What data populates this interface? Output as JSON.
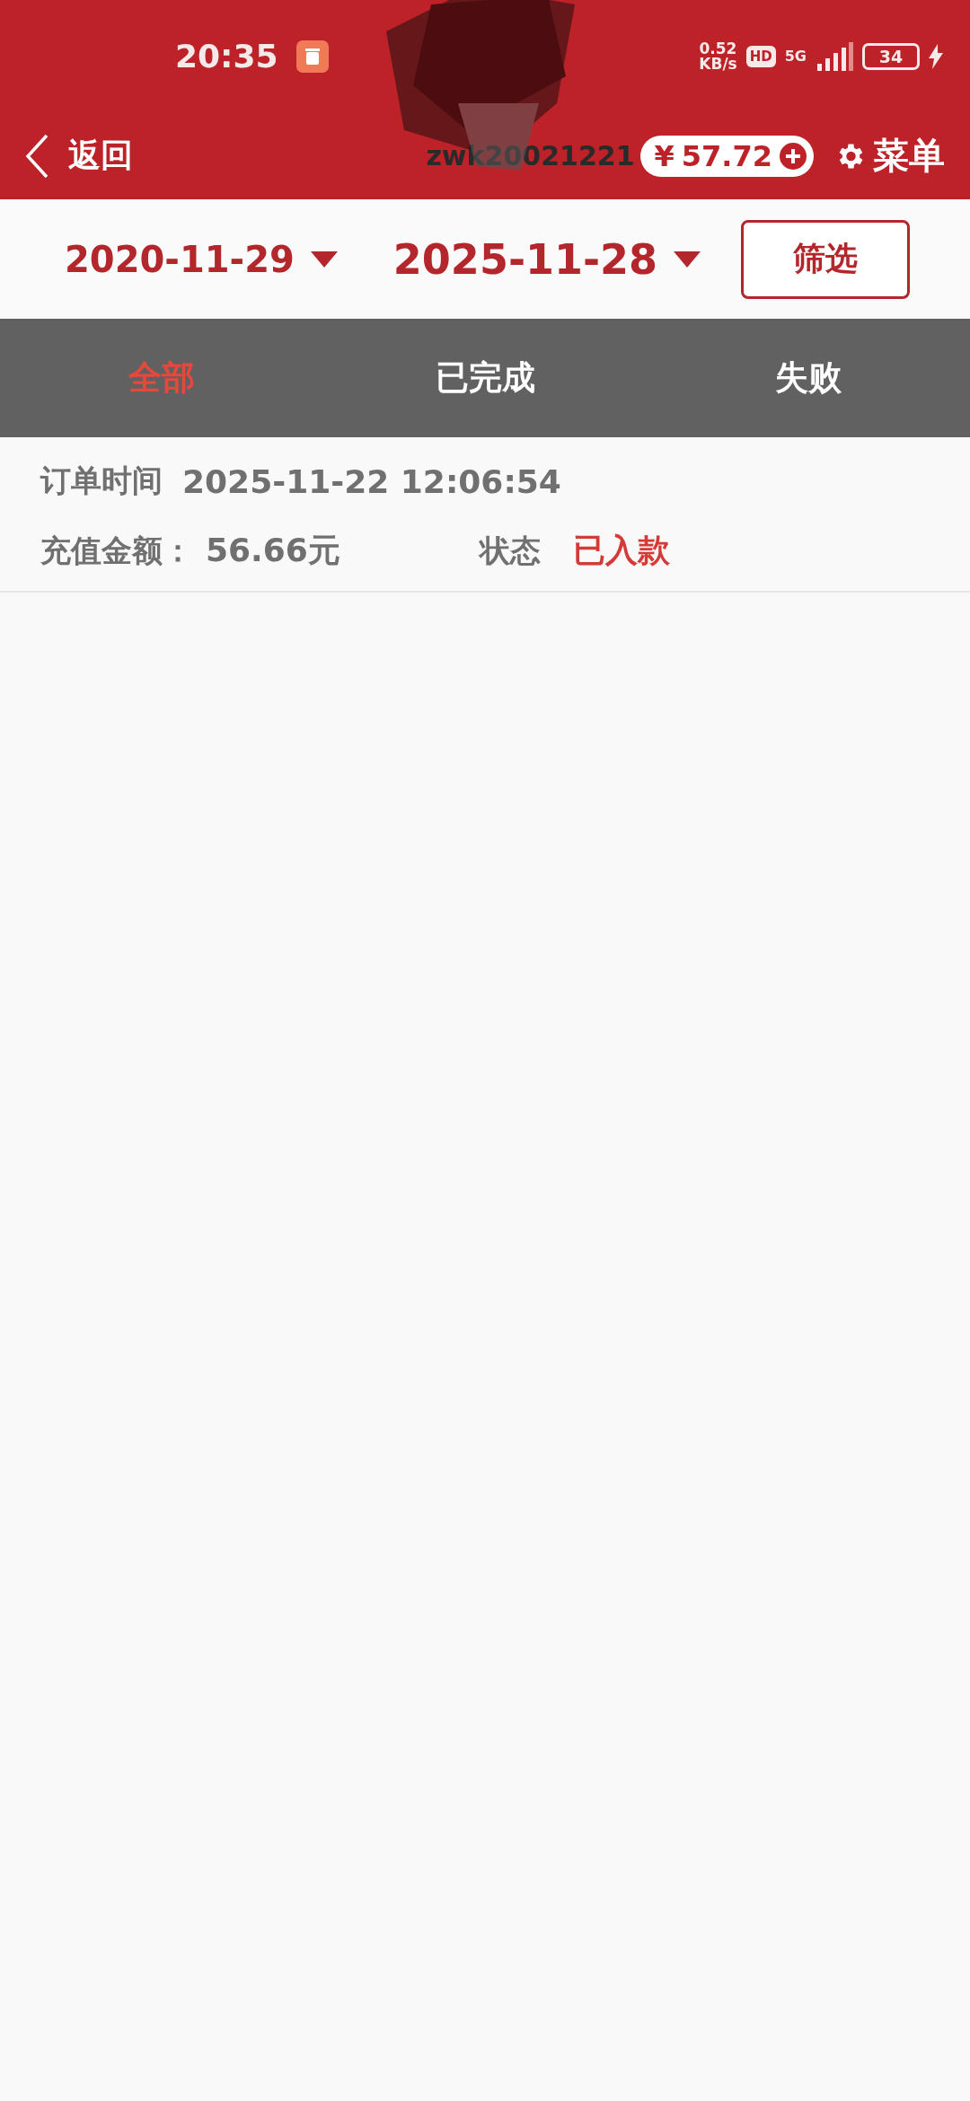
{
  "status_bar": {
    "time": "20:35",
    "speed_value": "0.52",
    "speed_unit": "KB/s",
    "hd_badge": "HD",
    "network": "5G",
    "battery": "34",
    "charging": true
  },
  "header": {
    "back_label": "返回",
    "username": "zwk20021221",
    "balance": "57.72",
    "currency": "¥",
    "menu_label": "菜单"
  },
  "date_filter": {
    "start_date": "2020-11-29",
    "end_date": "2025-11-28",
    "filter_button": "筛选"
  },
  "tabs": [
    {
      "label": "全部",
      "selected": true
    },
    {
      "label": "已完成",
      "selected": false
    },
    {
      "label": "失败",
      "selected": false
    }
  ],
  "orders": [
    {
      "time_label": "订单时间",
      "time": "2025-11-22 12:06:54",
      "amount_label": "充值金额：",
      "amount": "56.66元",
      "status_label": "状态",
      "status": "已入款",
      "color": "#d63a36"
    }
  ]
}
